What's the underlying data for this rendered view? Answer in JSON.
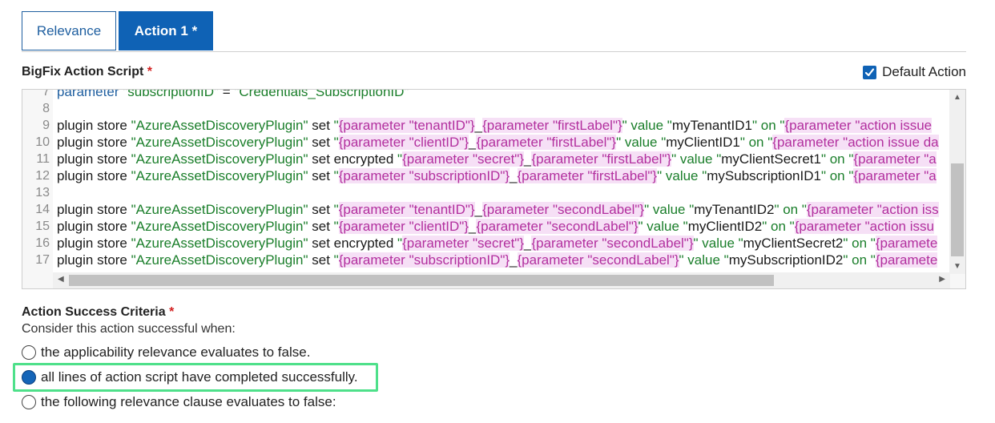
{
  "tabs": [
    {
      "label": "Relevance",
      "active": false
    },
    {
      "label": "Action 1 *",
      "active": true
    }
  ],
  "script_section": {
    "title": "BigFix Action Script",
    "required_mark": "*",
    "default_action_label": "Default Action",
    "default_action_checked": true
  },
  "code_lines": [
    {
      "num": "7",
      "text": "parameter \"subscriptionID\" = \"Credentials_SubscriptionID\""
    },
    {
      "num": "8",
      "text": ""
    },
    {
      "num": "9",
      "text": "plugin store \"AzureAssetDiscoveryPlugin\" set \"{parameter \"tenantID\"}_{parameter \"firstLabel\"}\" value \"myTenantID1\" on \"{parameter \"action issue"
    },
    {
      "num": "10",
      "text": "plugin store \"AzureAssetDiscoveryPlugin\" set \"{parameter \"clientID\"}_{parameter \"firstLabel\"}\" value \"myClientID1\" on \"{parameter \"action issue da"
    },
    {
      "num": "11",
      "text": "plugin store \"AzureAssetDiscoveryPlugin\" set encrypted \"{parameter \"secret\"}_{parameter \"firstLabel\"}\" value \"myClientSecret1\" on \"{parameter \"a"
    },
    {
      "num": "12",
      "text": "plugin store \"AzureAssetDiscoveryPlugin\" set \"{parameter \"subscriptionID\"}_{parameter \"firstLabel\"}\" value \"mySubscriptionID1\" on \"{parameter \"a"
    },
    {
      "num": "13",
      "text": ""
    },
    {
      "num": "14",
      "text": "plugin store \"AzureAssetDiscoveryPlugin\" set \"{parameter \"tenantID\"}_{parameter \"secondLabel\"}\" value \"myTenantID2\" on \"{parameter \"action iss"
    },
    {
      "num": "15",
      "text": "plugin store \"AzureAssetDiscoveryPlugin\" set \"{parameter \"clientID\"}_{parameter \"secondLabel\"}\" value \"myClientID2\" on \"{parameter \"action issu"
    },
    {
      "num": "16",
      "text": "plugin store \"AzureAssetDiscoveryPlugin\" set encrypted \"{parameter \"secret\"}_{parameter \"secondLabel\"}\" value \"myClientSecret2\" on \"{paramete"
    },
    {
      "num": "17",
      "text": "plugin store \"AzureAssetDiscoveryPlugin\" set \"{parameter \"subscriptionID\"}_{parameter \"secondLabel\"}\" value \"mySubscriptionID2\" on \"{paramete"
    }
  ],
  "criteria": {
    "title": "Action Success Criteria",
    "required_mark": "*",
    "subtitle": "Consider this action successful when:",
    "options": [
      {
        "label": "the applicability relevance evaluates to false.",
        "selected": false
      },
      {
        "label": "all lines of action script have completed successfully.",
        "selected": true
      },
      {
        "label": "the following relevance clause evaluates to false:",
        "selected": false
      }
    ]
  },
  "colors": {
    "accent": "#0f62b5",
    "highlight": "#4ee08a",
    "string": "#1a7e2a",
    "parameter": "#b22f9e"
  }
}
